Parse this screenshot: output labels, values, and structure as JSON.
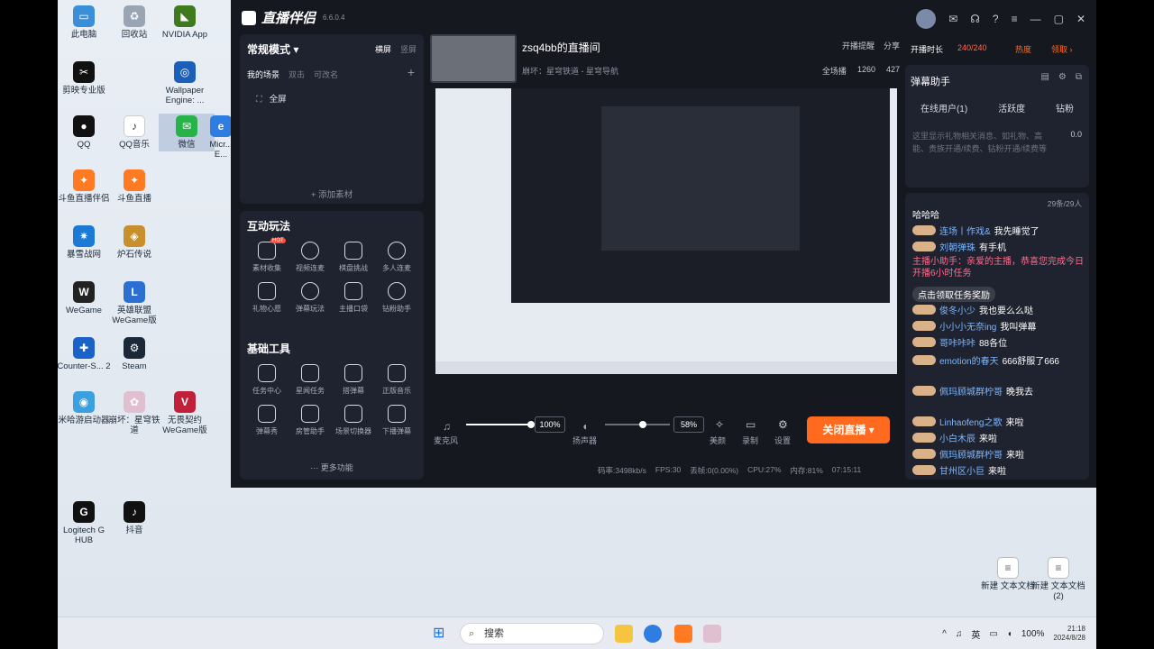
{
  "desktop": {
    "icons": [
      {
        "label": "此电脑",
        "color": "#3a8fd8"
      },
      {
        "label": "回收站",
        "color": "#9aa5b3"
      },
      {
        "label": "NVIDIA App",
        "color": "#3f7b1e"
      },
      {
        "label": "剪映专业版",
        "color": "#111111"
      },
      {
        "label": "Wallpaper Engine: ...",
        "color": "#1b5fb8"
      },
      {
        "label": "QQ",
        "color": "#111111"
      },
      {
        "label": "QQ音乐",
        "color": "#ffffff"
      },
      {
        "label": "微信",
        "color": "#27b34a"
      },
      {
        "label": "Micr... E...",
        "color": "#2f7de1"
      },
      {
        "label": "斗鱼直播伴侣",
        "color": "#ff7a22"
      },
      {
        "label": "斗鱼直播",
        "color": "#ff7a22"
      },
      {
        "label": "暴雪战网",
        "color": "#1a7ad6"
      },
      {
        "label": "炉石传说",
        "color": "#c8902c"
      },
      {
        "label": "WeGame",
        "color": "#222222"
      },
      {
        "label": "英雄联盟 WeGame版",
        "color": "#2b6fd0"
      },
      {
        "label": "Counter-S... 2",
        "color": "#1a62c7"
      },
      {
        "label": "Steam",
        "color": "#1b2838"
      },
      {
        "label": "米哈游启动器",
        "color": "#3aa0e0"
      },
      {
        "label": "崩坏：星穹铁道",
        "color": "#e0c0d0"
      },
      {
        "label": "无畏契约 WeGame版",
        "color": "#c0203a"
      },
      {
        "label": "Logitech G HUB",
        "color": "#111111"
      },
      {
        "label": "抖音",
        "color": "#111111"
      },
      {
        "label": "新建 文本文档",
        "color": "#ffffff"
      },
      {
        "label": "新建 文本文档 (2)",
        "color": "#ffffff"
      }
    ]
  },
  "app": {
    "title": "直播伴侣",
    "version": "6.6.0.4",
    "left": {
      "mode": "常规模式 ▾",
      "mode_tabs": [
        "横屏",
        "竖屏"
      ],
      "scene_tabs": [
        "我的场景",
        "双击",
        "可改名"
      ],
      "scene_item": "全屏",
      "add_source": "+ 添加素材",
      "interact_title": "互动玩法",
      "interact_items": [
        "素材收集",
        "视频连麦",
        "棋盘挑战",
        "多人连麦",
        "礼物心愿",
        "弹幕玩法",
        "主播口袋",
        "钻粉助手"
      ],
      "hot_badge": "HOT",
      "tools_title": "基础工具",
      "tools_items": [
        "任务中心",
        "星闻任务",
        "搭弹幕",
        "正版音乐",
        "弹幕秀",
        "房管助手",
        "场景切换器",
        "下播弹幕"
      ],
      "more": "··· 更多功能"
    },
    "room": {
      "name": "zsq4bb的直播间",
      "sub": "崩坏：星穹铁道 - 星穹导航",
      "top_actions": [
        "开播提醒",
        "分享"
      ],
      "stats": [
        "全场播",
        "1260",
        "427"
      ]
    },
    "controls": {
      "mic_label": "麦克风",
      "mic_pct": "100%",
      "speaker_label": "扬声器",
      "speaker_pct": "58%",
      "mic_level": 1.0,
      "speaker_level": 0.58,
      "beauty": "美颜",
      "record": "录制",
      "settings": "设置",
      "close_live": "关闭直播 ▾"
    },
    "status": {
      "bitrate": "码率:3498kb/s",
      "fps": "FPS:30",
      "drop": "丢帧:0(0.00%)",
      "cpu": "CPU:27%",
      "mem": "内存:81%",
      "time": "07:15:11"
    },
    "right": {
      "duration_label": "开播时长",
      "duration_value": "240/240",
      "hot": "热度",
      "claim": "领取 ›",
      "danmu_title": "弹幕助手",
      "online_tabs": [
        "在线用户(1)",
        "活跃度",
        "钻粉"
      ],
      "notice": "这里显示礼物相关消息、如礼物、高能、贵族开通/续费、钻粉开通/续费等",
      "gift_value": "0.0",
      "chat_count": "29条/29人",
      "chat": [
        {
          "name": "哈哈哈",
          "text": ""
        },
        {
          "name": "连场丨作戏&",
          "text": "我先睡觉了"
        },
        {
          "name": "刘朝弹珠",
          "text": "有手机"
        },
        {
          "name": "主播小助手：",
          "text": "亲爱的主播，恭喜您完成今日开播6小时任务"
        },
        {
          "name": "",
          "text": "点击领取任务奖励"
        },
        {
          "name": "俊冬小少",
          "text": "我也要么么哒"
        },
        {
          "name": "小小小无奈ing",
          "text": "我叫弹幕"
        },
        {
          "name": "哥咔咔咔",
          "text": "88各位"
        },
        {
          "name": "emotion的春天",
          "text": "666舒服了666"
        },
        {
          "name": "佩玛顾城群柠哥",
          "text": "晚我去"
        },
        {
          "name": "Linhaofeng之歌",
          "text": "来啦"
        },
        {
          "name": "小白木辰",
          "text": "来啦"
        },
        {
          "name": "佩玛顾城群柠哥",
          "text": "来啦"
        },
        {
          "name": "甘州区小巨",
          "text": "来啦"
        }
      ]
    }
  },
  "taskbar": {
    "search": "搜索",
    "ime": "英",
    "battery": "100%",
    "time": "21:18",
    "date": "2024/8/28"
  }
}
